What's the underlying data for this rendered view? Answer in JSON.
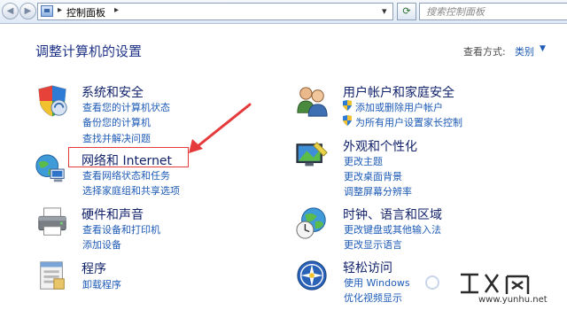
{
  "addressbar": {
    "breadcrumb": "控制面板",
    "search_placeholder": "搜索控制面板"
  },
  "header": {
    "title": "调整计算机的设置",
    "view_by_label": "查看方式:",
    "view_by_value": "类别"
  },
  "categories": {
    "system": {
      "title": "系统和安全",
      "links": [
        "查看您的计算机状态",
        "备份您的计算机",
        "查找并解决问题"
      ]
    },
    "network": {
      "title": "网络和 Internet",
      "links": [
        "查看网络状态和任务",
        "选择家庭组和共享选项"
      ]
    },
    "hardware": {
      "title": "硬件和声音",
      "links": [
        "查看设备和打印机",
        "添加设备"
      ]
    },
    "programs": {
      "title": "程序",
      "links": [
        "卸载程序"
      ]
    },
    "users": {
      "title": "用户帐户和家庭安全",
      "links": [
        "添加或删除用户帐户",
        "为所有用户设置家长控制"
      ]
    },
    "appearance": {
      "title": "外观和个性化",
      "links": [
        "更改主题",
        "更改桌面背景",
        "调整屏幕分辨率"
      ]
    },
    "clock": {
      "title": "时钟、语言和区域",
      "links": [
        "更改键盘或其他输入法",
        "更改显示语言"
      ]
    },
    "ease": {
      "title": "轻松访问",
      "links": [
        "使用 Windows",
        "优化视频显示"
      ]
    }
  },
  "watermark": {
    "url": "www.yunhu.net"
  },
  "colors": {
    "link": "#1e5bb6",
    "title": "#12236b",
    "highlight": "#e53a3a"
  }
}
